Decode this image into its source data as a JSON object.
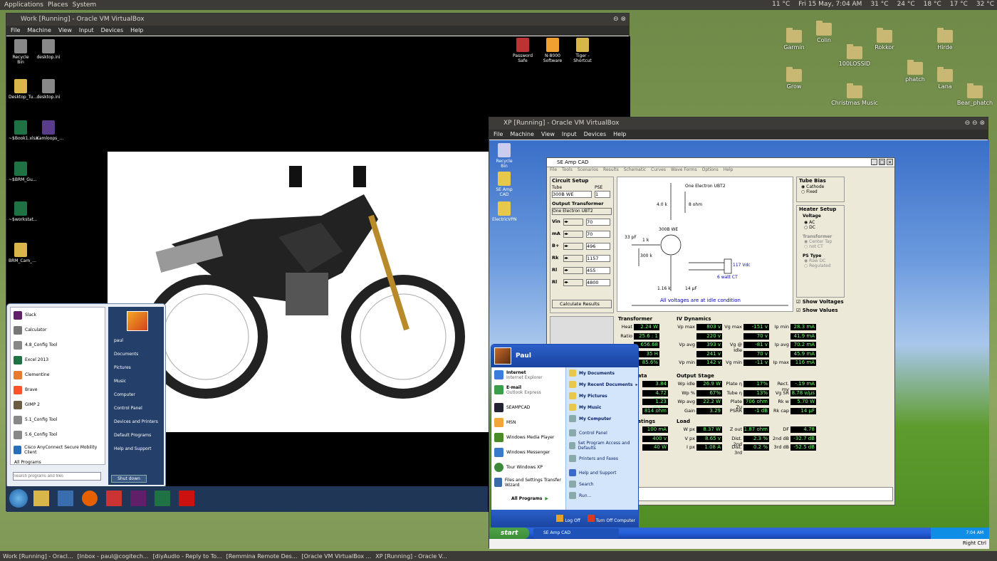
{
  "top_panel": {
    "applications": "Applications",
    "places": "Places",
    "system": "System",
    "temp1": "11 °C",
    "datetime": "Fri 15 May,  7:04 AM",
    "t2": "31 °C",
    "t3": "24 °C",
    "t4": "18 °C",
    "t5": "17 °C",
    "t6": "32 °C"
  },
  "desktop_icons": [
    "Garmin",
    "Colin",
    "100LOSSID",
    "Rokkor",
    "Hirde",
    "Grow",
    "phatch",
    "Lana",
    "Christmas Music",
    "Bear_phatch"
  ],
  "work_window": {
    "title": "Work [Running] - Oracle VM VirtualBox",
    "menu": [
      "File",
      "Machine",
      "View",
      "Input",
      "Devices",
      "Help"
    ],
    "icons": [
      "Recycle Bin",
      "desktop.ini",
      "Desktop_Tu...",
      "desktop.ini",
      "~$Book1.xlsx",
      "Kamloops_...",
      "~$BRM_Gu...",
      "~$workstat...",
      "BRM_Cam_..."
    ],
    "right_icons": [
      "Password Safe",
      "N-8000 Software",
      "Tiger - Shortcut"
    ],
    "start_left": [
      "Slack",
      "Calculator",
      "4.8_Config Tool",
      "Excel 2013",
      "Clementine",
      "Brave",
      "GIMP 2",
      "5.1_Config Tool",
      "5.6_Config Tool",
      "Cisco AnyConnect Secure Mobility Client",
      "All Programs"
    ],
    "search_placeholder": "Search programs and files",
    "start_right": [
      "paul",
      "Documents",
      "Pictures",
      "Music",
      "Computer",
      "Control Panel",
      "Devices and Printers",
      "Default Programs",
      "Help and Support"
    ],
    "shutdown": "Shut down"
  },
  "xp_window": {
    "title": "XP [Running] - Oracle VM VirtualBox",
    "menu": [
      "File",
      "Machine",
      "View",
      "Input",
      "Devices",
      "Help"
    ],
    "desktop_icons": [
      "Recycle Bin",
      "SE Amp CAD",
      "ElectricVPN"
    ],
    "statusbar": "Right Ctrl",
    "clock": "7:04 AM",
    "taskbar_item": "SE Amp CAD",
    "start_button": "start"
  },
  "seamp": {
    "title": "SE Amp CAD",
    "menu": [
      "File",
      "Tools",
      "Scenarios",
      "Results",
      "Schematic",
      "Curves",
      "Wave Forms",
      "Options",
      "Help"
    ],
    "circuit_setup": "Circuit Setup",
    "tube_lbl": "Tube",
    "tube": "300B WE",
    "pse_lbl": "PSE",
    "pse": "1",
    "ot_lbl": "Output Transformer",
    "ot": "One Electron UBT2",
    "params": [
      {
        "l": "Vin",
        "v": "70"
      },
      {
        "l": "mA",
        "v": "70"
      },
      {
        "l": "B+",
        "v": "496"
      },
      {
        "l": "Rk",
        "v": "1157"
      },
      {
        "l": "Rl",
        "v": "455"
      },
      {
        "l": "Rl",
        "v": "4800"
      }
    ],
    "calc": "Calculate Results",
    "schematic_note": "All voltages are at idle condition",
    "sch_labels": [
      "One Electron UBT2",
      "4.0 k",
      "8 ohm",
      "300B WE",
      "300 k",
      "1 k",
      "33 pF",
      "1.16 k",
      "14 µF",
      "117 Vdc",
      "6 watt CT"
    ],
    "tube_bias": "Tube Bias",
    "cathode": "Cathode",
    "fixed": "Fixed",
    "heater": "Heater Setup",
    "voltage": "Voltage",
    "ac": "AC",
    "dc": "DC",
    "transformer": "Transformer",
    "center_tap": "Center Tap",
    "not_ct": "not CT",
    "ps_type": "PS Type",
    "raw_dc": "Raw DC",
    "regulated": "Regulated",
    "show_voltages": "Show Voltages",
    "show_values": "Show Values",
    "transformer_box": {
      "title": "Transformer",
      "rows": [
        [
          "Heat",
          "2.24 W"
        ],
        [
          "Ratio",
          "25.6 : 1"
        ],
        [
          "",
          "656.68"
        ],
        [
          "",
          "35 H"
        ],
        [
          "",
          "85.6%"
        ]
      ]
    },
    "iv": {
      "title": "IV Dynamics",
      "rows": [
        [
          "Vp max",
          "803 v",
          "Vg max",
          "-151 v",
          "Ip min",
          "28.3 mA"
        ],
        [
          "",
          "220 v",
          "",
          "70 v",
          "",
          "41.9 mA"
        ],
        [
          "Vp avg",
          "393 v",
          "Vg @ Idle",
          "-81 v",
          "Ip avg",
          "70.2 mA"
        ],
        [
          "",
          "241 v",
          "",
          "70 v",
          "",
          "45.9 mA"
        ],
        [
          "Vp min",
          "142 v",
          "Vg min",
          "-11 v",
          "Ip max",
          "116 mA"
        ]
      ]
    },
    "data": {
      "title": "Data",
      "vals": [
        "3.84",
        "4.72 mA/v",
        "1.23 mA/v",
        "814 ohm"
      ]
    },
    "stage": {
      "title": "Output Stage",
      "rows": [
        [
          "Wp idle",
          "26.9 W",
          "Plate η",
          "17%",
          "Rect. mv",
          "-.19 mA"
        ],
        [
          "Wp %",
          "67%",
          "Tube η",
          "13%",
          "Vg SR",
          "8.78 v/µs"
        ],
        [
          "Wp avg",
          "22.2 W",
          "Plate Zu",
          "706 ohm",
          "Rk w",
          "5.70 W"
        ],
        [
          "Gain",
          "3.29",
          "PSRR",
          "-1 dB",
          "Rk cap",
          "14 µF"
        ]
      ]
    },
    "ratings": {
      "title": "Ratings",
      "vals": [
        "100 mA",
        "400 v",
        "40 W"
      ]
    },
    "load": {
      "title": "Load",
      "rows": [
        [
          "W px",
          "8.37 W",
          "Z out",
          "1.87 ohm",
          "DF",
          "4.78"
        ],
        [
          "V px",
          "8.65 v",
          "Dist. 2nd",
          "2.3 %",
          "2nd dB",
          "-32.7 dB"
        ],
        [
          "I px",
          "1.08 A",
          "Dist. 3rd",
          "0.2 %",
          "3rd dB",
          "-52.5 dB"
        ]
      ]
    }
  },
  "xp_start": {
    "user": "Paul",
    "left": [
      {
        "t": "Internet",
        "s": "Internet Explorer"
      },
      {
        "t": "E-mail",
        "s": "Outlook Express"
      },
      {
        "t": "SEAMPCAD",
        "s": ""
      },
      {
        "t": "MSN",
        "s": ""
      },
      {
        "t": "Windows Media Player",
        "s": ""
      },
      {
        "t": "Windows Messenger",
        "s": ""
      },
      {
        "t": "Tour Windows XP",
        "s": ""
      },
      {
        "t": "Files and Settings Transfer Wizard",
        "s": ""
      }
    ],
    "all_programs": "All Programs",
    "right": [
      "My Documents",
      "My Recent Documents",
      "My Pictures",
      "My Music",
      "My Computer",
      "Control Panel",
      "Set Program Access and Defaults",
      "Printers and Faxes",
      "Help and Support",
      "Search",
      "Run..."
    ],
    "logoff": "Log Off",
    "turnoff": "Turn Off Computer"
  },
  "bottom_taskbar": [
    "Work [Running] - Oracl...",
    "[Inbox - paul@cogitech...",
    "[diyAudio - Reply to To...",
    "[Remmina Remote Des...",
    "[Oracle VM VirtualBox ...",
    "XP [Running] - Oracle V..."
  ]
}
